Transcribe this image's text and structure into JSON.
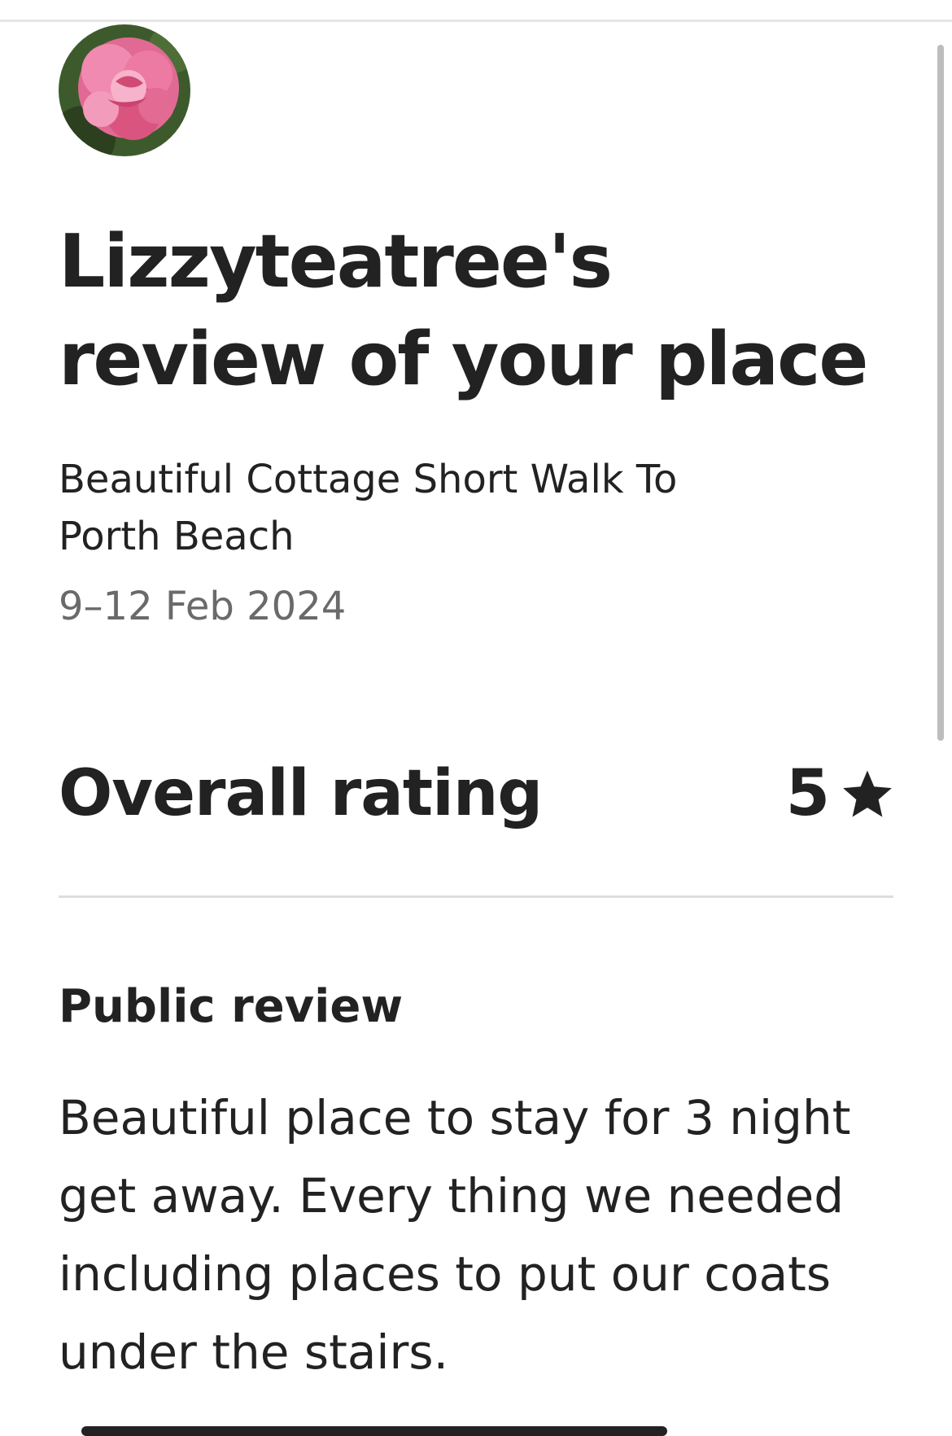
{
  "header": {
    "title": "Lizzyteatree's review of your place",
    "avatar_icon": "reviewer-avatar-pink-flower"
  },
  "listing": {
    "name": "Beautiful Cottage Short Walk To Porth Beach",
    "dates": "9–12 Feb 2024"
  },
  "rating": {
    "label": "Overall rating",
    "value": "5",
    "icon": "star-icon"
  },
  "public_review": {
    "heading": "Public review",
    "text": "Beautiful place to stay for 3 night get away. Every thing we needed including places to put our coats under the stairs."
  },
  "colors": {
    "text_primary": "#222222",
    "text_secondary": "#6a6a6a",
    "divider": "#dddddd",
    "avatar_flower": "#e8608c"
  }
}
